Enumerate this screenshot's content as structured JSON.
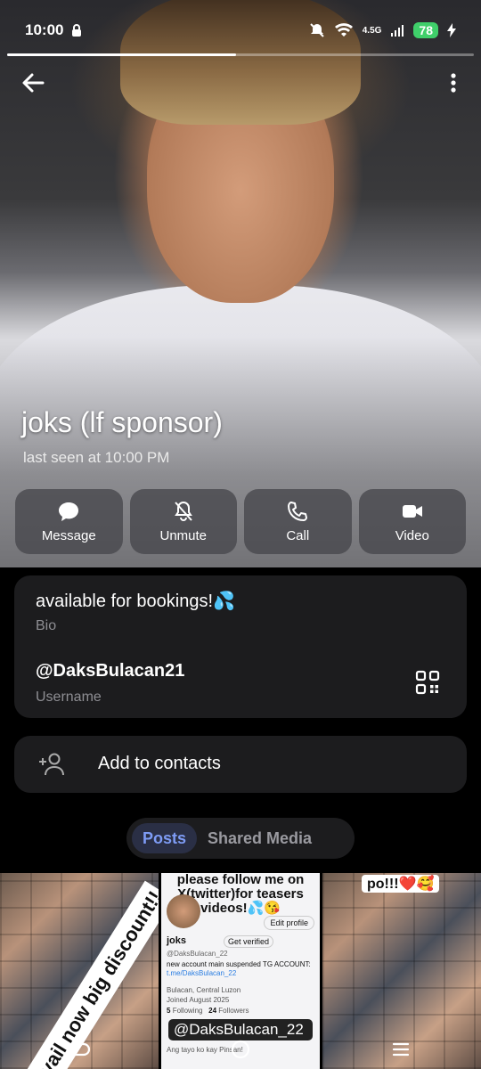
{
  "status_bar": {
    "time": "10:00",
    "network": "4.5G",
    "battery": "78"
  },
  "story_progress": 0.49,
  "profile": {
    "name": "joks (lf sponsor)",
    "last_seen": "last seen at 10:00 PM"
  },
  "actions": [
    {
      "label": "Message",
      "icon": "message-icon"
    },
    {
      "label": "Unmute",
      "icon": "bell-off-icon"
    },
    {
      "label": "Call",
      "icon": "phone-icon"
    },
    {
      "label": "Video",
      "icon": "video-icon"
    }
  ],
  "info": {
    "bio": "available for bookings!💦",
    "bio_label": "Bio",
    "username": "@DaksBulacan21",
    "username_label": "Username"
  },
  "add_contact": {
    "label": "Add to contacts",
    "icon": "add-person-icon"
  },
  "tabs": [
    {
      "label": "Posts",
      "active": true
    },
    {
      "label": "Shared Media",
      "active": false
    }
  ],
  "media": {
    "tile1_banner": "avail now big discount!!",
    "tile2": {
      "header": "please follow me on X(twitter)for teasers videos!💦😘",
      "edit_profile": "Edit profile",
      "name": "joks",
      "verified": "Get verified",
      "handle": "@DaksBulacan_22",
      "desc_prefix": "new account main suspended TG ACCOUNT:",
      "desc_link": "t.me/DaksBulacan_22",
      "location": "Bulacan, Central Luzon",
      "joined": "Joined August 2025",
      "following_count": "5",
      "following_label": "Following",
      "followers_count": "24",
      "followers_label": "Followers",
      "pill": "@DaksBulacan_22",
      "tweet": "Ang tayo ko kay Pinsan!"
    },
    "tile3_caption": "po!!!❤️🥰"
  },
  "colors": {
    "card_bg": "#1c1c1e",
    "accent": "#7e9cf5",
    "battery": "#3fcf6a"
  }
}
